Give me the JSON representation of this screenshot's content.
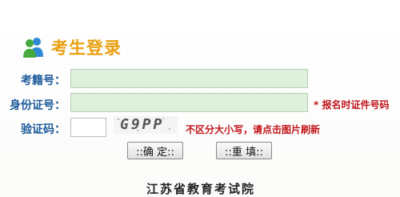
{
  "title": "考生登录",
  "title_color": "#e8a00f",
  "label_color": "#1b5a9a",
  "note_color": "#c0141a",
  "field_bg": "#dff1dc",
  "icon": "users-icon",
  "form": {
    "exam_id_label": "考籍号：",
    "exam_id_value": "",
    "id_card_label": "身份证号：",
    "id_card_value": "",
    "id_card_note": "* 报名时证件号码",
    "captcha_label": "验证码：",
    "captcha_value": "",
    "captcha_image_text": "G9PP",
    "captcha_note": "不区分大小写，请点击图片刷新"
  },
  "buttons": {
    "confirm": "::确 定::",
    "reset": "::重 填::"
  },
  "footer": "江苏省教育考试院"
}
